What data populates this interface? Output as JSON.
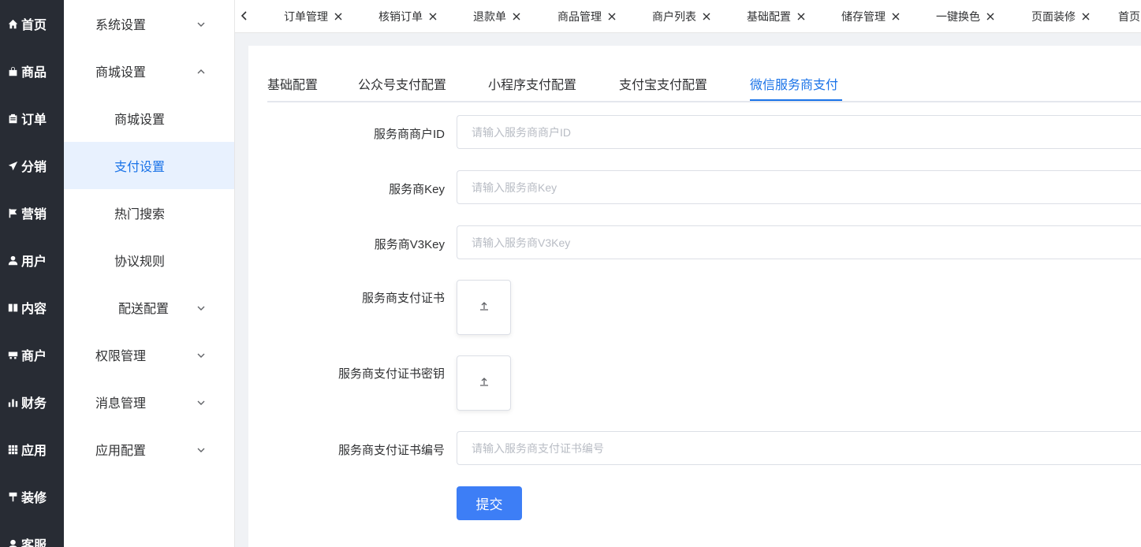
{
  "nav": {
    "items": [
      {
        "label": "首页",
        "icon": "home-icon"
      },
      {
        "label": "商品",
        "icon": "bag-icon"
      },
      {
        "label": "订单",
        "icon": "clipboard-icon"
      },
      {
        "label": "分销",
        "icon": "send-icon"
      },
      {
        "label": "营销",
        "icon": "flag-icon"
      },
      {
        "label": "用户",
        "icon": "user-icon"
      },
      {
        "label": "内容",
        "icon": "book-icon"
      },
      {
        "label": "商户",
        "icon": "store-icon"
      },
      {
        "label": "财务",
        "icon": "bar-chart-icon"
      },
      {
        "label": "应用",
        "icon": "grid-icon"
      },
      {
        "label": "装修",
        "icon": "paint-roller-icon"
      },
      {
        "label": "客服",
        "icon": "service-icon"
      }
    ]
  },
  "submenu": {
    "items": [
      {
        "label": "系统设置",
        "chevron": "down"
      },
      {
        "label": "商城设置",
        "chevron": "up"
      },
      {
        "label": "商城设置"
      },
      {
        "label": "支付设置",
        "active": true
      },
      {
        "label": "热门搜索"
      },
      {
        "label": "协议规则"
      },
      {
        "label": "配送配置",
        "chevron": "down"
      },
      {
        "label": "权限管理",
        "chevron": "down"
      },
      {
        "label": "消息管理",
        "chevron": "down"
      },
      {
        "label": "应用配置",
        "chevron": "down"
      }
    ]
  },
  "tabs": {
    "items": [
      {
        "label": "订单管理"
      },
      {
        "label": "核销订单"
      },
      {
        "label": "退款单"
      },
      {
        "label": "商品管理"
      },
      {
        "label": "商户列表"
      },
      {
        "label": "基础配置"
      },
      {
        "label": "储存管理"
      },
      {
        "label": "一键换色"
      },
      {
        "label": "页面装修"
      },
      {
        "label": "首页"
      }
    ]
  },
  "page_tabs": {
    "items": [
      {
        "label": "基础配置"
      },
      {
        "label": "公众号支付配置"
      },
      {
        "label": "小程序支付配置"
      },
      {
        "label": "支付宝支付配置"
      },
      {
        "label": "微信服务商支付",
        "active": true
      }
    ]
  },
  "form": {
    "merchant_id": {
      "label": "服务商商户ID",
      "placeholder": "请输入服务商商户ID",
      "value": ""
    },
    "key": {
      "label": "服务商Key",
      "placeholder": "请输入服务商Key",
      "value": ""
    },
    "v3key": {
      "label": "服务商V3Key",
      "placeholder": "请输入服务商V3Key",
      "value": ""
    },
    "cert": {
      "label": "服务商支付证书"
    },
    "cert_key": {
      "label": "服务商支付证书密钥"
    },
    "cert_no": {
      "label": "服务商支付证书编号",
      "placeholder": "请输入服务商支付证书编号",
      "value": ""
    },
    "submit_label": "提交"
  },
  "colors": {
    "nav_bg": "#282c34",
    "accent": "#1a73e8",
    "active_bg": "#e8f1fe",
    "submit_bg": "#3d7ef6"
  }
}
